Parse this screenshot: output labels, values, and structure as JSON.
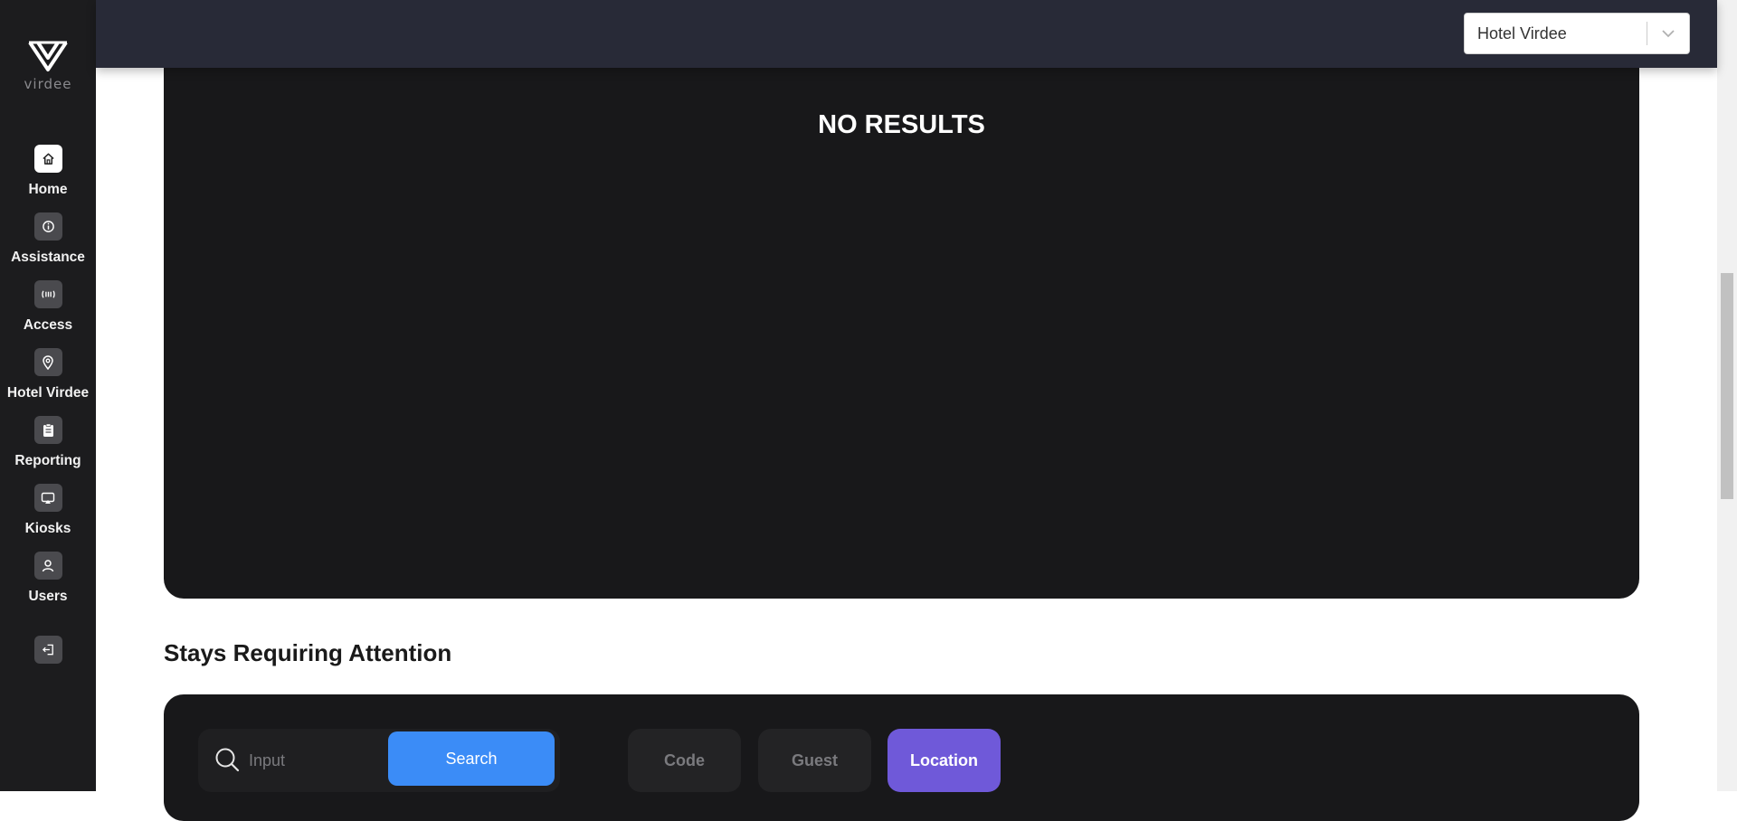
{
  "brand": {
    "name": "virdee"
  },
  "sidebar": {
    "items": [
      {
        "label": "Home",
        "icon": "home-icon",
        "active": true
      },
      {
        "label": "Assistance",
        "icon": "info-icon",
        "active": false
      },
      {
        "label": "Access",
        "icon": "access-icon",
        "active": false
      },
      {
        "label": "Hotel Virdee",
        "icon": "location-pin-icon",
        "active": false
      },
      {
        "label": "Reporting",
        "icon": "clipboard-icon",
        "active": false
      },
      {
        "label": "Kiosks",
        "icon": "kiosk-icon",
        "active": false
      },
      {
        "label": "Users",
        "icon": "user-icon",
        "active": false
      }
    ],
    "logout_icon": "logout-icon"
  },
  "header": {
    "hotel_selector": {
      "value": "Hotel Virdee"
    }
  },
  "results": {
    "empty_text": "NO RESULTS"
  },
  "stays": {
    "title": "Stays Requiring Attention",
    "search": {
      "placeholder": "Input",
      "value": "",
      "button_label": "Search"
    },
    "filters": [
      {
        "label": "Code",
        "active": false
      },
      {
        "label": "Guest",
        "active": false
      },
      {
        "label": "Location",
        "active": true
      }
    ]
  },
  "colors": {
    "sidebar_bg": "#1c1c1e",
    "topbar_bg": "#282a37",
    "card_bg": "#18181a",
    "search_button": "#3b8cf7",
    "active_filter": "#6f59d9"
  }
}
